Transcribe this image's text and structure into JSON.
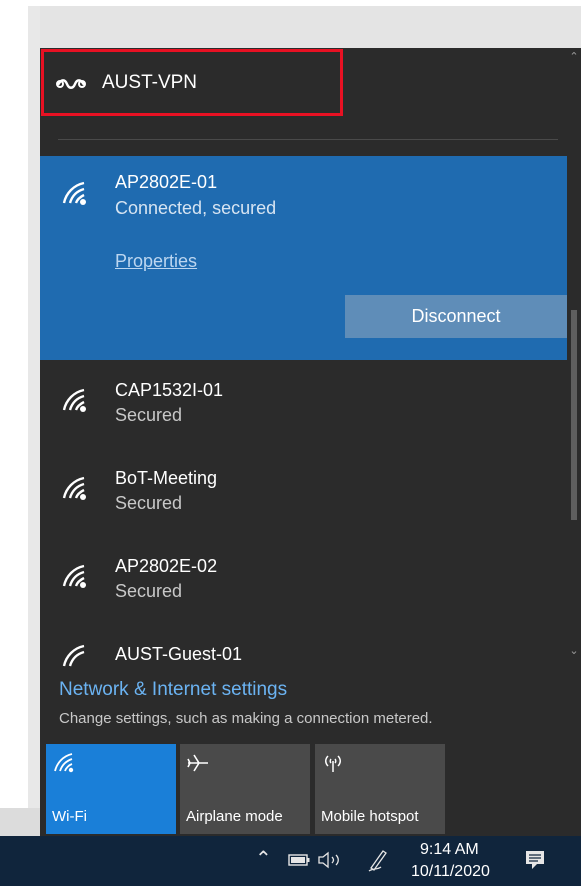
{
  "vpn": {
    "name": "AUST-VPN",
    "icon": "vpn-icon"
  },
  "connected_network": {
    "name": "AP2802E-01",
    "status": "Connected, secured",
    "properties_label": "Properties",
    "disconnect_label": "Disconnect",
    "icon": "wifi-signal-icon"
  },
  "networks": [
    {
      "name": "CAP1532I-01",
      "status": "Secured"
    },
    {
      "name": "BoT-Meeting",
      "status": "Secured"
    },
    {
      "name": "AP2802E-02",
      "status": "Secured"
    },
    {
      "name": "AUST-Guest-01",
      "status": ""
    }
  ],
  "settings": {
    "link": "Network & Internet settings",
    "description": "Change settings, such as making a connection metered."
  },
  "tiles": [
    {
      "label": "Wi-Fi",
      "icon": "wifi-icon",
      "active": true
    },
    {
      "label": "Airplane mode",
      "icon": "airplane-icon",
      "active": false
    },
    {
      "label": "Mobile hotspot",
      "icon": "mobile-hotspot-icon",
      "active": false
    }
  ],
  "taskbar": {
    "time": "9:14 AM",
    "date": "10/11/2020",
    "icons": [
      "chevron-up-icon",
      "battery-icon",
      "volume-icon",
      "pen-icon",
      "action-center-icon"
    ]
  },
  "colors": {
    "flyout_bg": "#2b2b2b",
    "connected_bg": "#1f6bb0",
    "accent_tile": "#1a7fd8",
    "link": "#6bb3f2",
    "highlight_box": "#e81123",
    "taskbar_bg": "#10253c"
  }
}
